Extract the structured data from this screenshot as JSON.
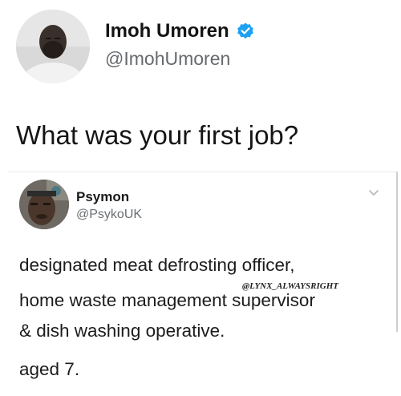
{
  "tweet": {
    "author": {
      "display_name": "Imoh Umoren",
      "handle": "@ImohUmoren",
      "verified": true,
      "avatar_icon": "profile-photo",
      "verified_icon": "verified-badge-icon"
    },
    "text": "What was your first job?",
    "accent_color": "#1da1f2"
  },
  "reply": {
    "author": {
      "display_name": "Psymon",
      "handle": "@PsykoUK",
      "avatar_icon": "profile-photo"
    },
    "menu_icon": "chevron-down-icon",
    "lines": [
      "designated meat defrosting officer,",
      "home waste management supervisor",
      "& dish washing operative.",
      "aged 7."
    ]
  },
  "watermark": "@LYNX_ALWAYSRIGHT"
}
